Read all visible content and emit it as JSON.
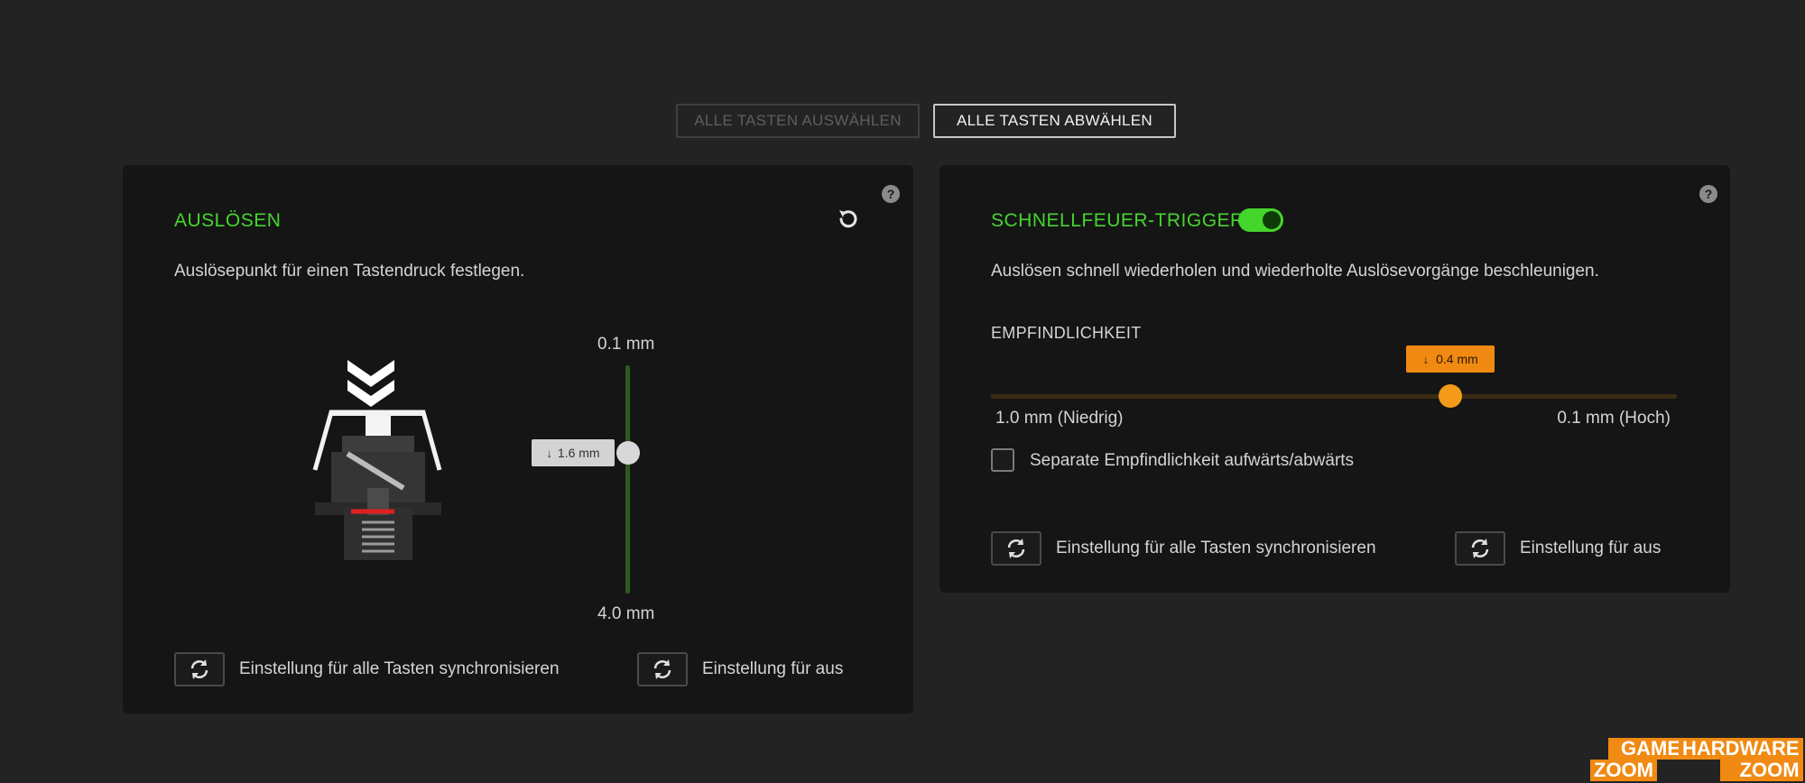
{
  "toolbar": {
    "select_all_label": "ALLE TASTEN AUSWÄHLEN",
    "deselect_all_label": "ALLE TASTEN ABWÄHLEN"
  },
  "actuation_panel": {
    "title": "AUSLÖSEN",
    "description": "Auslösepunkt für einen Tastendruck festlegen.",
    "slider": {
      "top_label": "0.1 mm",
      "bottom_label": "4.0 mm",
      "value_label": "1.6 mm",
      "min_mm": 0.1,
      "max_mm": 4.0,
      "value_mm": 1.6
    },
    "sync_all_label": "Einstellung für alle Tasten synchronisieren",
    "sync_selected_label": "Einstellung für aus"
  },
  "rapid_trigger_panel": {
    "title": "SCHNELLFEUER-TRIGGER",
    "toggle_on": true,
    "description": "Auslösen schnell wiederholen und wiederholte Auslösevorgänge beschleunigen.",
    "sensitivity_label": "EMPFINDLICHKEIT",
    "slider": {
      "value_label": "0.4 mm",
      "left_label": "1.0 mm (Niedrig)",
      "right_label": "0.1 mm (Hoch)",
      "value_fraction": 0.67
    },
    "separate_sensitivity_label": "Separate Empfindlichkeit aufwärts/abwärts",
    "separate_sensitivity_checked": false,
    "sync_all_label": "Einstellung für alle Tasten synchronisieren",
    "sync_selected_label": "Einstellung für aus"
  },
  "watermark": {
    "left_top": "GAME",
    "left_bottom": "ZOOM",
    "right_top": "HARDWARE",
    "right_bottom": "ZOOM"
  },
  "colors": {
    "accent_green": "#44d62c",
    "accent_orange": "#f08a12",
    "background": "#232323",
    "panel": "#151515"
  },
  "icons": {
    "help": "question-mark-icon",
    "reset": "reset-icon",
    "sync": "sync-icon",
    "actuation": "chevrons-down-icon",
    "switch": "switch-illustration"
  }
}
